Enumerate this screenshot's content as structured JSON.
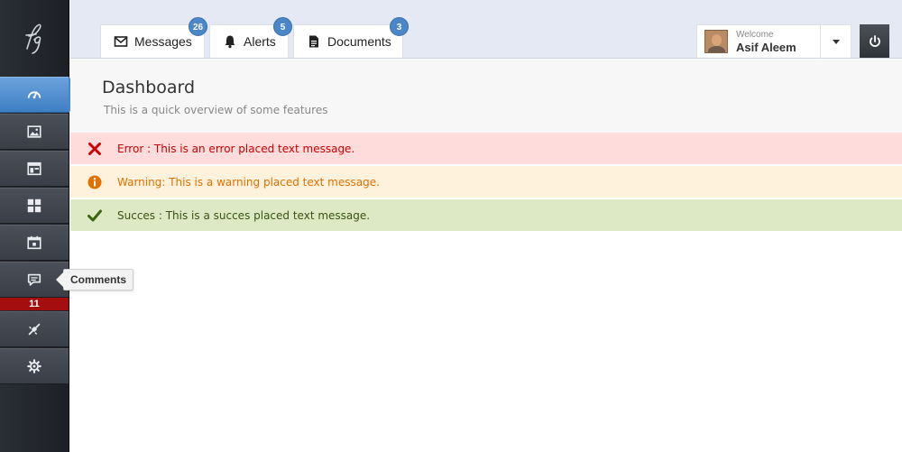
{
  "logo": {
    "text": "fg"
  },
  "sidebar": {
    "items": [
      {
        "icon": "dashboard-icon",
        "active": true
      },
      {
        "icon": "image-icon"
      },
      {
        "icon": "layout-icon"
      },
      {
        "icon": "grid-icon"
      },
      {
        "icon": "calendar-icon"
      },
      {
        "icon": "comment-icon",
        "badge": "11",
        "tooltip": "Comments"
      },
      {
        "icon": "plug-icon"
      },
      {
        "icon": "gear-icon"
      }
    ]
  },
  "header": {
    "tabs": [
      {
        "label": "Messages",
        "badge": "26",
        "icon": "envelope-icon"
      },
      {
        "label": "Alerts",
        "badge": "5",
        "icon": "bell-icon"
      },
      {
        "label": "Documents",
        "badge": "3",
        "icon": "document-icon"
      }
    ],
    "user": {
      "welcome": "Welcome",
      "name": "Asif Aleem"
    }
  },
  "page": {
    "title": "Dashboard",
    "subtitle": "This is a quick overview of some features"
  },
  "alerts": {
    "error": "Error : This is an error placed text message.",
    "warning": "Warning: This is a warning placed text message.",
    "success": "Succes : This is a succes placed text message."
  },
  "colors": {
    "accent": "#4a86c8",
    "error": "#cc0000",
    "warning": "#e07000",
    "success": "#3a5214",
    "badge_red": "#a40e0e"
  }
}
